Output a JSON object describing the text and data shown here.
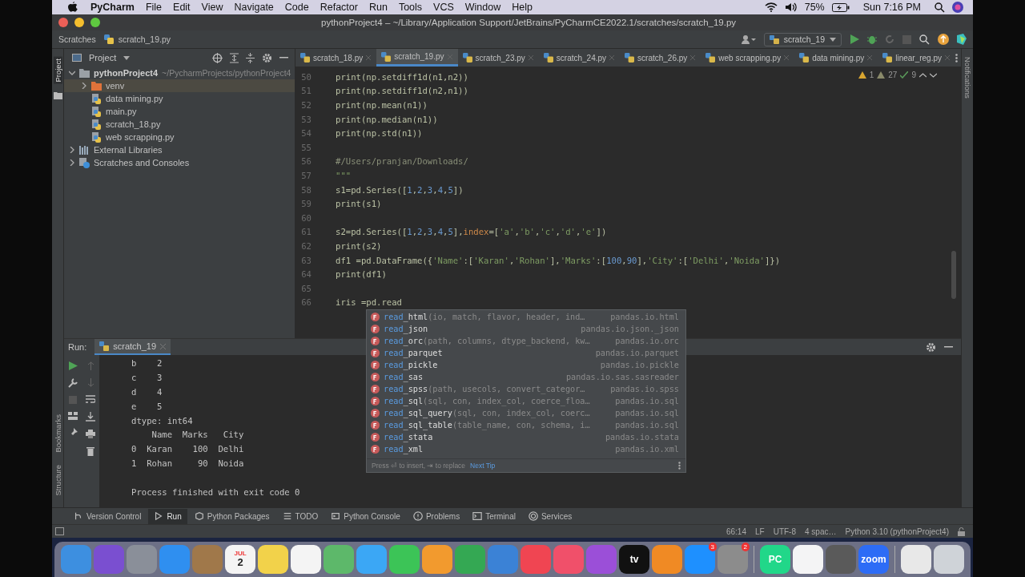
{
  "menu_bar": {
    "app": "PyCharm",
    "items": [
      "File",
      "Edit",
      "View",
      "Navigate",
      "Code",
      "Refactor",
      "Run",
      "Tools",
      "VCS",
      "Window",
      "Help"
    ],
    "battery": "75%",
    "clock": "Sun 7:16 PM"
  },
  "window": {
    "title": "pythonProject4 – ~/Library/Application Support/JetBrains/PyCharmCE2022.1/scratches/scratch_19.py"
  },
  "nav_bar": {
    "breadcrumbs": [
      "Scratches",
      "scratch_19.py"
    ],
    "run_config": "scratch_19"
  },
  "side_labels": {
    "left_top": "Project",
    "left_bottom": [
      "Bookmarks",
      "Structure"
    ],
    "right": "Notifications"
  },
  "project_panel": {
    "title": "Project",
    "tree": [
      {
        "label": "pythonProject4",
        "hint": "~/PycharmProjects/pythonProject4",
        "kind": "module",
        "expanded": true,
        "selected": false,
        "children": [
          {
            "label": "venv",
            "kind": "folder",
            "expanded": false,
            "selected": true
          },
          {
            "label": "data mining.py",
            "kind": "python",
            "selected": false
          },
          {
            "label": "main.py",
            "kind": "python",
            "selected": false
          },
          {
            "label": "scratch_18.py",
            "kind": "python",
            "selected": false
          },
          {
            "label": "web scrapping.py",
            "kind": "python",
            "selected": false
          }
        ]
      },
      {
        "label": "External Libraries",
        "kind": "library",
        "expanded": false,
        "selected": false
      },
      {
        "label": "Scratches and Consoles",
        "kind": "scratches",
        "expanded": false,
        "selected": false
      }
    ]
  },
  "editor": {
    "tabs": [
      {
        "label": "scratch_18.py",
        "selected": false
      },
      {
        "label": "scratch_19.py",
        "selected": true
      },
      {
        "label": "scratch_23.py",
        "selected": false
      },
      {
        "label": "scratch_24.py",
        "selected": false
      },
      {
        "label": "scratch_26.py",
        "selected": false
      },
      {
        "label": "web scrapping.py",
        "selected": false
      },
      {
        "label": "data mining.py",
        "selected": false
      },
      {
        "label": "linear_reg.py",
        "selected": false
      }
    ],
    "inspections": {
      "warnings": "1",
      "weak_warnings": "27",
      "typos": "9"
    },
    "lines": [
      {
        "number": "50",
        "tokens": [
          {
            "kind": "code",
            "t": "print(np.setdiff1d(n1,n2))"
          }
        ]
      },
      {
        "number": "51",
        "tokens": [
          {
            "kind": "code",
            "t": "print(np.setdiff1d(n2,n1))"
          }
        ]
      },
      {
        "number": "52",
        "tokens": [
          {
            "kind": "code",
            "t": "print(np.mean(n1))"
          }
        ]
      },
      {
        "number": "53",
        "tokens": [
          {
            "kind": "code",
            "t": "print(np.median(n1))"
          }
        ]
      },
      {
        "number": "54",
        "tokens": [
          {
            "kind": "code",
            "t": "print(np.std(n1))"
          }
        ]
      },
      {
        "number": "55"
      },
      {
        "number": "56",
        "tokens": [
          {
            "kind": "comment",
            "t": "#/Users/pranjan/Downloads/"
          }
        ]
      },
      {
        "number": "57",
        "tokens": [
          {
            "kind": "str",
            "t": "\"\"\""
          }
        ]
      },
      {
        "number": "58",
        "tokens": [
          {
            "kind": "code",
            "t": "s1=pd.Series(["
          },
          {
            "kind": "num",
            "t": "1"
          },
          {
            "kind": "code",
            "t": ","
          },
          {
            "kind": "num",
            "t": "2"
          },
          {
            "kind": "code",
            "t": ","
          },
          {
            "kind": "num",
            "t": "3"
          },
          {
            "kind": "code",
            "t": ","
          },
          {
            "kind": "num",
            "t": "4"
          },
          {
            "kind": "code",
            "t": ","
          },
          {
            "kind": "num",
            "t": "5"
          },
          {
            "kind": "code",
            "t": "])"
          }
        ]
      },
      {
        "number": "59",
        "tokens": [
          {
            "kind": "code",
            "t": "print(s1)"
          }
        ]
      },
      {
        "number": "60"
      },
      {
        "number": "61",
        "tokens": [
          {
            "kind": "code",
            "t": "s2=pd.Series(["
          },
          {
            "kind": "num",
            "t": "1"
          },
          {
            "kind": "code",
            "t": ","
          },
          {
            "kind": "num",
            "t": "2"
          },
          {
            "kind": "code",
            "t": ","
          },
          {
            "kind": "num",
            "t": "3"
          },
          {
            "kind": "code",
            "t": ","
          },
          {
            "kind": "num",
            "t": "4"
          },
          {
            "kind": "code",
            "t": ","
          },
          {
            "kind": "num",
            "t": "5"
          },
          {
            "kind": "code",
            "t": "],"
          },
          {
            "kind": "param",
            "t": "index"
          },
          {
            "kind": "code",
            "t": "=["
          },
          {
            "kind": "str",
            "t": "'a'"
          },
          {
            "kind": "code",
            "t": ","
          },
          {
            "kind": "str",
            "t": "'b'"
          },
          {
            "kind": "code",
            "t": ","
          },
          {
            "kind": "str",
            "t": "'c'"
          },
          {
            "kind": "code",
            "t": ","
          },
          {
            "kind": "str",
            "t": "'d'"
          },
          {
            "kind": "code",
            "t": ","
          },
          {
            "kind": "str",
            "t": "'e'"
          },
          {
            "kind": "code",
            "t": "])"
          }
        ]
      },
      {
        "number": "62",
        "tokens": [
          {
            "kind": "code",
            "t": "print(s2)"
          }
        ]
      },
      {
        "number": "63",
        "tokens": [
          {
            "kind": "code",
            "t": "df1 =pd.DataFrame({"
          },
          {
            "kind": "str",
            "t": "'Name'"
          },
          {
            "kind": "code",
            "t": ":["
          },
          {
            "kind": "str",
            "t": "'Karan'"
          },
          {
            "kind": "code",
            "t": ","
          },
          {
            "kind": "str",
            "t": "'Rohan'"
          },
          {
            "kind": "code",
            "t": "],"
          },
          {
            "kind": "str",
            "t": "'Marks'"
          },
          {
            "kind": "code",
            "t": ":["
          },
          {
            "kind": "num",
            "t": "100"
          },
          {
            "kind": "code",
            "t": ","
          },
          {
            "kind": "num",
            "t": "90"
          },
          {
            "kind": "code",
            "t": "],"
          },
          {
            "kind": "str",
            "t": "'City'"
          },
          {
            "kind": "code",
            "t": ":["
          },
          {
            "kind": "str",
            "t": "'Delhi'"
          },
          {
            "kind": "code",
            "t": ","
          },
          {
            "kind": "str",
            "t": "'Noida'"
          },
          {
            "kind": "code",
            "t": "]})"
          }
        ]
      },
      {
        "number": "64",
        "tokens": [
          {
            "kind": "code",
            "t": "print(df1)"
          }
        ]
      },
      {
        "number": "65"
      },
      {
        "number": "66",
        "tokens": [
          {
            "kind": "code",
            "t": "iris =pd.read"
          }
        ]
      }
    ]
  },
  "completion": {
    "items": [
      {
        "match": "read",
        "rest": "_html",
        "params": "(io, match, flavor, header, ind…",
        "module": "pandas.io.html"
      },
      {
        "match": "read",
        "rest": "_json",
        "module": "pandas.io.json._json"
      },
      {
        "match": "read",
        "rest": "_orc",
        "params": "(path, columns, dtype_backend, kw…",
        "module": "pandas.io.orc"
      },
      {
        "match": "read",
        "rest": "_parquet",
        "module": "pandas.io.parquet"
      },
      {
        "match": "read",
        "rest": "_pickle",
        "module": "pandas.io.pickle"
      },
      {
        "match": "read",
        "rest": "_sas",
        "module": "pandas.io.sas.sasreader"
      },
      {
        "match": "read",
        "rest": "_spss",
        "params": "(path, usecols, convert_categor…",
        "module": "pandas.io.spss"
      },
      {
        "match": "read",
        "rest": "_sql",
        "params": "(sql, con, index_col, coerce_floa…",
        "module": "pandas.io.sql"
      },
      {
        "match": "read",
        "rest": "_sql_query",
        "params": "(sql, con, index_col, coerc…",
        "module": "pandas.io.sql"
      },
      {
        "match": "read",
        "rest": "_sql_table",
        "params": "(table_name, con, schema, i…",
        "module": "pandas.io.sql"
      },
      {
        "match": "read",
        "rest": "_stata",
        "module": "pandas.io.stata"
      },
      {
        "match": "read",
        "rest": "_xml",
        "module": "pandas.io.xml"
      }
    ],
    "hint": "Press ⏎ to insert, ⇥ to replace",
    "next_tip": "Next Tip"
  },
  "run_panel": {
    "label": "Run:",
    "tab": "scratch_19",
    "output": [
      "b    2",
      "c    3",
      "d    4",
      "e    5",
      "dtype: int64",
      "    Name  Marks   City",
      "0  Karan    100  Delhi",
      "1  Rohan     90  Noida"
    ],
    "exit_message": "Process finished with exit code 0"
  },
  "tool_windows": [
    {
      "label": "Version Control",
      "kind": "vcs",
      "selected": false
    },
    {
      "label": "Run",
      "kind": "run",
      "selected": true
    },
    {
      "label": "Python Packages",
      "kind": "packages",
      "selected": false
    },
    {
      "label": "TODO",
      "kind": "todo",
      "selected": false
    },
    {
      "label": "Python Console",
      "kind": "console",
      "selected": false
    },
    {
      "label": "Problems",
      "kind": "problems",
      "selected": false
    },
    {
      "label": "Terminal",
      "kind": "terminal",
      "selected": false
    },
    {
      "label": "Services",
      "kind": "services",
      "selected": false
    }
  ],
  "status_bar": {
    "items": [
      "66:14",
      "LF",
      "UTF-8",
      "4 spac…",
      "Python 3.10 (pythonProject4)"
    ]
  },
  "dock": {
    "groups": [
      {
        "items": [
          {
            "color": "#3d8fe0"
          },
          {
            "color": "#7a4fd0"
          },
          {
            "color": "#8a8f99"
          },
          {
            "color": "#2f8ff0"
          },
          {
            "color": "#a0784a"
          },
          {
            "color": "#f4f4f4",
            "glyph": "2",
            "caption": "JUL"
          },
          {
            "color": "#f2d24a"
          },
          {
            "color": "#f4f4f4"
          },
          {
            "color": "#5db86a"
          },
          {
            "color": "#3ba7f5"
          },
          {
            "color": "#3cc457"
          },
          {
            "color": "#f29a2e"
          },
          {
            "color": "#34a853"
          },
          {
            "color": "#3b82d6"
          },
          {
            "color": "#f04552"
          },
          {
            "color": "#f0506a"
          },
          {
            "color": "#9b4fd8"
          },
          {
            "color": "#111111",
            "glyph": "tv"
          },
          {
            "color": "#f08a24"
          },
          {
            "color": "#1e90ff",
            "badge": "3"
          },
          {
            "color": "#8c8c8c",
            "badge": "2"
          }
        ]
      },
      {
        "items": [
          {
            "color": "#21d789",
            "glyph": "PC"
          },
          {
            "color": "#f4f4f5"
          },
          {
            "color": "#5a5a5a"
          },
          {
            "color": "#2d6cf6",
            "glyph": "zoom"
          }
        ]
      },
      {
        "items": [
          {
            "color": "#e8e8e8"
          },
          {
            "color": "#cfd3d8"
          }
        ]
      }
    ]
  }
}
